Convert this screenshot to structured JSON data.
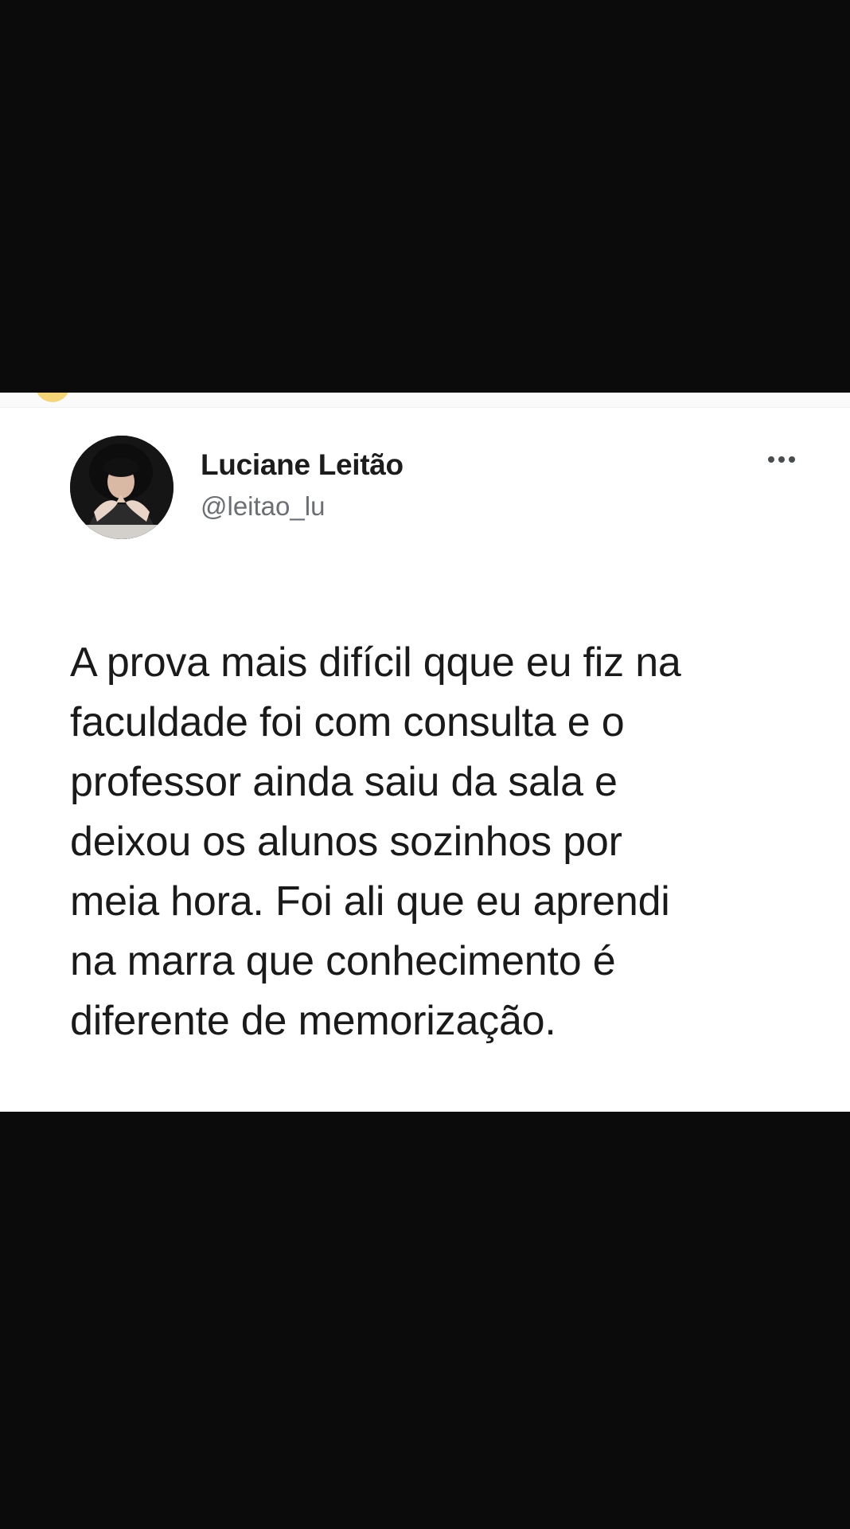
{
  "tweet": {
    "display_name": "Luciane Leitão",
    "handle": "@leitao_lu",
    "more_icon": "more-horizontal-icon",
    "text_lines": [
      "A prova mais difícil qque eu fiz na",
      "faculdade foi com consulta e o",
      "professor ainda saiu da sala e",
      "deixou os alunos sozinhos por",
      "meia hora. Foi ali que eu aprendi",
      "na marra que conhecimento é",
      "diferente de memorização."
    ]
  },
  "colors": {
    "background": "#0b0b0b",
    "card": "#ffffff",
    "name": "#1c1c1c",
    "handle": "#6b6f73"
  }
}
